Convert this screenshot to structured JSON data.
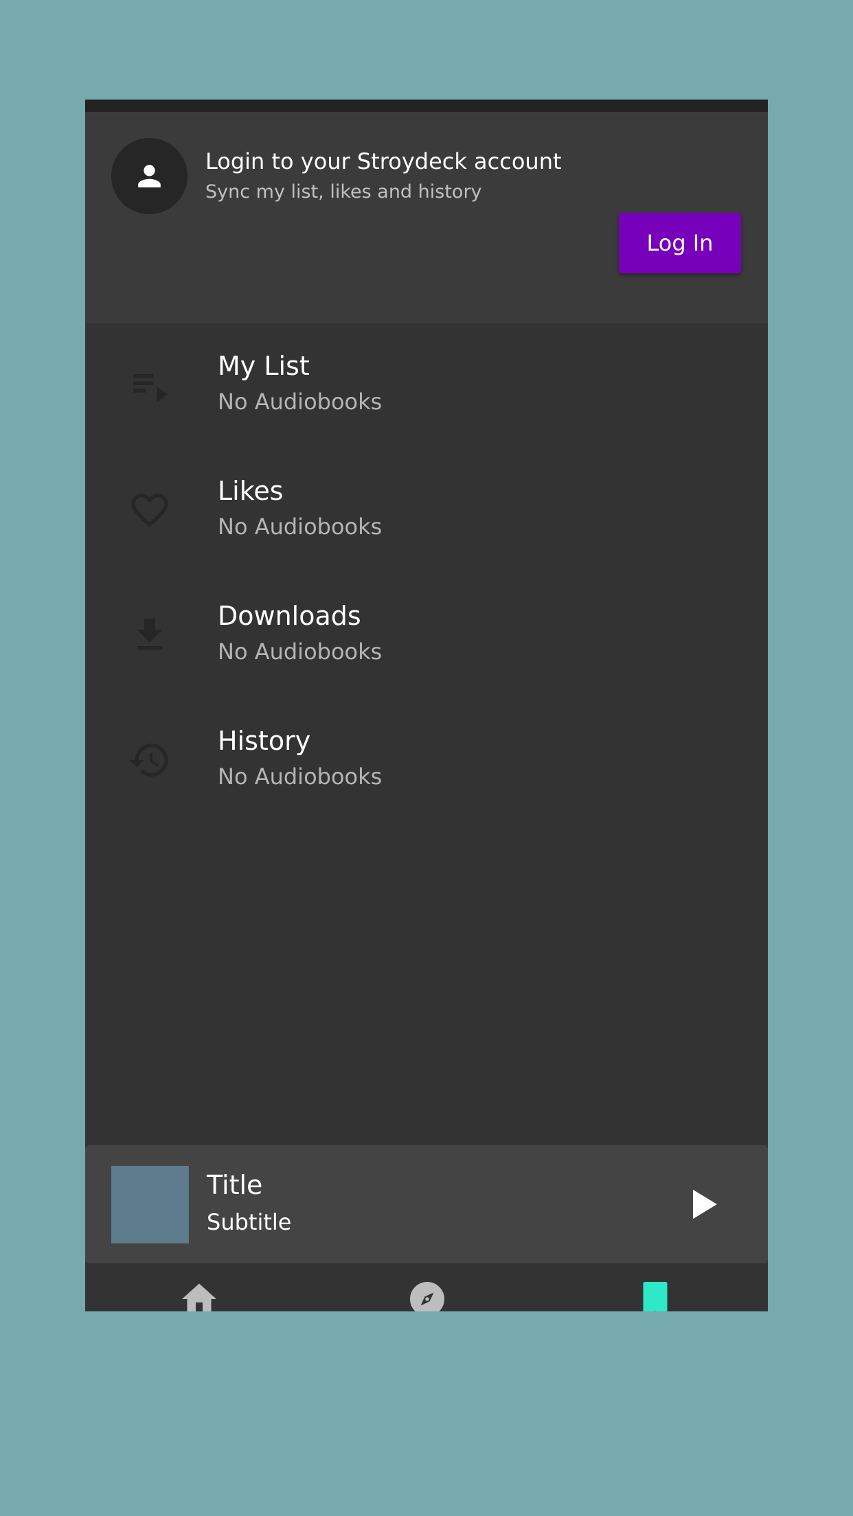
{
  "login": {
    "title": "Login to your Stroydeck account",
    "subtitle": "Sync my list, likes and history",
    "button_label": "Log In",
    "button_color": "#7700bb"
  },
  "library": {
    "items": [
      {
        "icon": "playlist-icon",
        "title": "My List",
        "subtitle": "No Audiobooks"
      },
      {
        "icon": "heart-icon",
        "title": "Likes",
        "subtitle": "No Audiobooks"
      },
      {
        "icon": "download-icon",
        "title": "Downloads",
        "subtitle": "No Audiobooks"
      },
      {
        "icon": "history-icon",
        "title": "History",
        "subtitle": "No Audiobooks"
      }
    ]
  },
  "player": {
    "title": "Title",
    "subtitle": "Subtitle",
    "icon": "play-icon"
  },
  "nav": {
    "tabs": [
      {
        "icon": "home-icon",
        "active": false
      },
      {
        "icon": "compass-icon",
        "active": false
      },
      {
        "icon": "bookmark-icon",
        "active": true
      }
    ],
    "active_color": "#2ee8c8",
    "inactive_color": "#bdbdbd"
  }
}
